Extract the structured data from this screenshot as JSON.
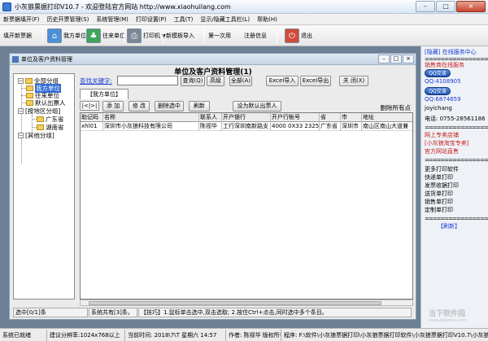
{
  "app": {
    "title": "小灰狼票据打印V10.7 - 欢迎登陆官方网站 http://www.xiaohuilang.com",
    "min": "–",
    "max": "□",
    "close": "×"
  },
  "menu": [
    "新票据填开(F)",
    "历史开票管理(S)",
    "系统管理(M)",
    "打印设置(P)",
    "工具(T)",
    "显示/隐藏工具栏(L)",
    "帮助(H)"
  ],
  "toolbar": {
    "new_ticket": "填开新票据",
    "my_unit": "我方单位",
    "other_unit": "往来单位",
    "printer": "打印机",
    "new_template": "新模板导入",
    "first_use": "第一次用",
    "register": "注册信息",
    "exit": "退出"
  },
  "child": {
    "title": "单位及客户资料管理",
    "panel_title": "单位及客户资料管理(1)",
    "tree": {
      "all": "全部分组",
      "my_unit": "我方单位",
      "other_unit": "往来单位",
      "default_payee": "默认出票人",
      "by_region": "[按地区分组]",
      "guangdong": "广东省",
      "hunan": "湖南省",
      "other": "[其他分组]"
    },
    "search": {
      "label": "查找关键字:",
      "value": "",
      "query": "查询(Q)",
      "advanced": "高级",
      "all": "全部(A)",
      "excel_import": "Excel导入",
      "excel_export": "Excel导出",
      "close": "关 闭(X)"
    },
    "tab": "【我方单位】",
    "nav": "|<|>|",
    "add": "添 加",
    "edit": "修 改",
    "delete_selected": "删除选中",
    "refresh": "刷新",
    "set_default_payee": "设为默认出票人",
    "delete_all": "删除所有点",
    "columns": [
      "助记码",
      "名称",
      "联系人",
      "开户银行",
      "开户行帐号",
      "省",
      "市",
      "地址"
    ],
    "rows": [
      [
        "xhl01",
        "深圳市小灰狼科技有限公司",
        "陈视华",
        "工行深圳南新路支",
        "4000 0X33 2325",
        "广东省",
        "深圳市",
        "南山区南山大道兼"
      ]
    ],
    "status": {
      "selected": "选中[0/1]条",
      "total": "系统共有[3]条。",
      "tips": "【技巧】1.鼠标单击选中,双击选取;   2.按住Ctrl+点击,同时选中多个条目。"
    }
  },
  "right": {
    "header": "[隐藏] 在线服务中心",
    "sales_title": "销售商在线服务",
    "qq1": "QQ:4108905",
    "qq2": "QQ:6874659",
    "qq_label": "QQ交谈",
    "phone": "电话: 0755-28561186",
    "store_title": "网上专卖店铺",
    "store_link": "[小灰狼淘宝专卖]",
    "official_site": "官方网站直售",
    "more_title": "更多打印软件",
    "soft1": "快递单打印",
    "soft2": "发票收据打印",
    "soft3": "送货单打印",
    "soft4": "销售单打印",
    "soft5": "定制单打印",
    "refresh": "【刷新】",
    "contact": "joyichang"
  },
  "status": {
    "ready": "系统已就绪",
    "resolution": "建议分辨率:1024x768以上",
    "time": "当前时间: 2018\\7\\T 星期六 14:57",
    "author": "作者: 陈视华 版权所有",
    "path": "程序: F:\\软件\\小灰狼票据打印\\小灰狼票据打印软件\\小灰狼票据打印V10.7\\小灰狼票据打印.exe"
  },
  "watermark": {
    "line1": "当下软件园",
    "line2": "www.downxia.com"
  },
  "colors": {
    "workspace": "#6c7f95",
    "selected": "#2f6bd6",
    "link": "#1a3bd1",
    "red": "#c81e1e"
  }
}
